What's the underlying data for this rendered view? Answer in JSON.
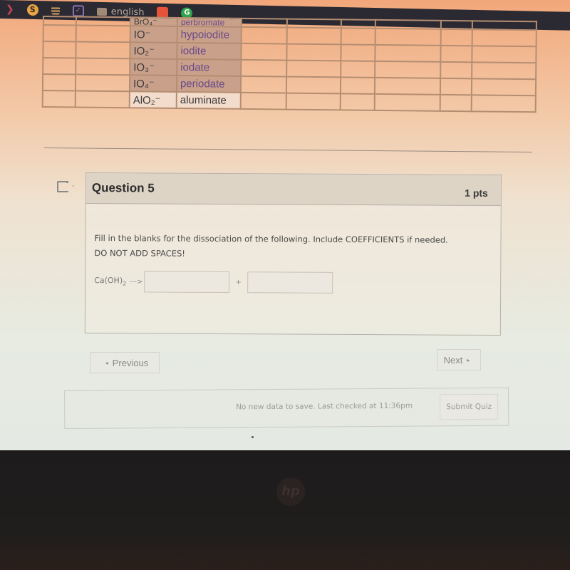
{
  "browser": {
    "bookmarks": [
      {
        "icon": "pocket-icon",
        "label": ""
      },
      {
        "icon": "s-circle-icon",
        "label": ""
      },
      {
        "icon": "grid-icon",
        "label": ""
      },
      {
        "icon": "checkbox-icon",
        "label": ""
      },
      {
        "icon": "folder-icon",
        "label": "english"
      },
      {
        "icon": "red-app-icon",
        "label": ""
      },
      {
        "icon": "grammarly-icon",
        "label": ""
      }
    ],
    "glyphs": {
      "pocket": "❯",
      "s": "S",
      "check": "✓",
      "g": "G"
    }
  },
  "ion_table": {
    "rows": [
      {
        "formula": "BrO₄⁻",
        "name": "perbromate",
        "cut": true
      },
      {
        "formula": "IO⁻",
        "name": "hypoiodite"
      },
      {
        "formula": "IO₂⁻",
        "name": "iodite"
      },
      {
        "formula": "IO₃⁻",
        "name": "iodate"
      },
      {
        "formula": "IO₄⁻",
        "name": "periodate"
      },
      {
        "formula": "AlO₂⁻",
        "name": "aluminate"
      }
    ]
  },
  "question": {
    "title": "Question 5",
    "points": "1 pts",
    "text_line1": "Fill in the blanks for the dissociation of the following. Include COEFFICIENTS if needed.",
    "text_line2": "DO NOT ADD SPACES!",
    "formula_main": "Ca(OH)",
    "formula_sub": "2",
    "arrow": "--->",
    "plus": "+",
    "blank1_value": "",
    "blank2_value": ""
  },
  "navigation": {
    "previous_label": "Previous",
    "previous_chevron": "◂",
    "next_label": "Next",
    "next_chevron": "▸"
  },
  "submit_bar": {
    "status": "No new data to save. Last checked at 11:36pm",
    "submit_label": "Submit Quiz"
  },
  "device": {
    "logo": "hp"
  }
}
